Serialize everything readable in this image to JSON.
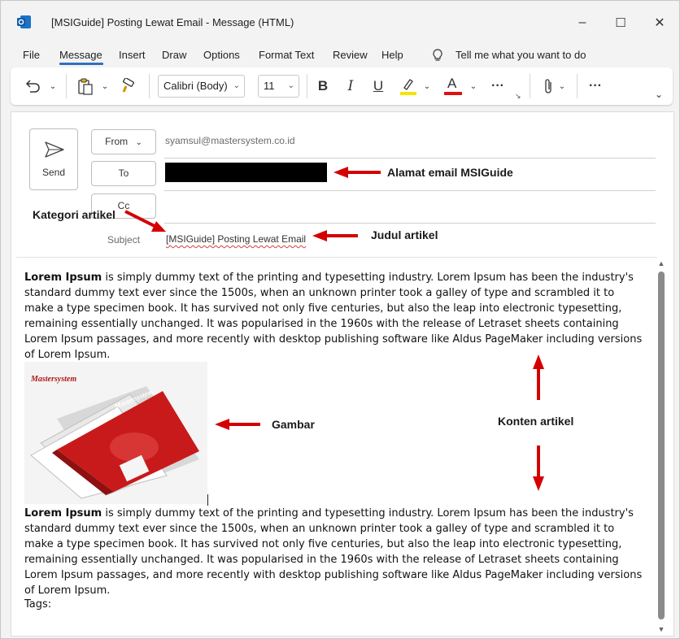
{
  "window": {
    "title": "[MSIGuide] Posting Lewat Email  -  Message (HTML)",
    "controls": {
      "minimize": "–",
      "maximize": "☐",
      "close": "✕"
    }
  },
  "menu": {
    "items": [
      "File",
      "Message",
      "Insert",
      "Draw",
      "Options",
      "Format Text",
      "Review",
      "Help"
    ],
    "active": "Message",
    "tell_me": "Tell me what you want to do"
  },
  "ribbon": {
    "font_name": "Calibri (Body)",
    "font_size": "11",
    "bold": "B",
    "italic": "I",
    "underline": "U",
    "font_color_letter": "A",
    "more": "···",
    "overflow": "···",
    "highlight_color": "#f2e600",
    "font_color": "#e01010"
  },
  "compose": {
    "send_label": "Send",
    "from_label": "From",
    "to_label": "To",
    "cc_label": "Cc",
    "from_address": "syamsul@mastersystem.co.id",
    "subject_label": "Subject",
    "subject_value": "[MSIGuide] Posting Lewat Email"
  },
  "annotations": {
    "email": "Alamat email MSIGuide",
    "category": "Kategori artikel",
    "title": "Judul artikel",
    "image": "Gambar",
    "content": "Konten artikel",
    "arrow_color": "#d40000"
  },
  "body": {
    "para1_bold": "Lorem Ipsum",
    "para1_rest": " is simply dummy text of the printing and typesetting industry. Lorem Ipsum has been the industry's standard dummy text ever since the 1500s, when an unknown printer took a galley of type and scrambled it to make a type specimen book. It has survived not only five centuries, but also the leap into electronic typesetting, remaining essentially unchanged. It was popularised in the 1960s with the release of Letraset sheets containing Lorem Ipsum passages, and more recently with desktop publishing software like Aldus PageMaker including versions of Lorem Ipsum.",
    "para2_bold": "Lorem Ipsum",
    "para2_rest": " is simply dummy text of the printing and typesetting industry. Lorem Ipsum has been the industry's standard dummy text ever since the 1500s, when an unknown printer took a galley of type and scrambled it to make a type specimen book. It has survived not only five centuries, but also the leap into electronic typesetting, remaining essentially unchanged. It was popularised in the 1960s with the release of Letraset sheets containing Lorem Ipsum passages, and more recently with desktop publishing software like Aldus PageMaker including versions of Lorem Ipsum.",
    "tags_label": "Tags:",
    "image_brand_top": "Mastersystem",
    "image_brand_cover": "Mastersystem"
  }
}
